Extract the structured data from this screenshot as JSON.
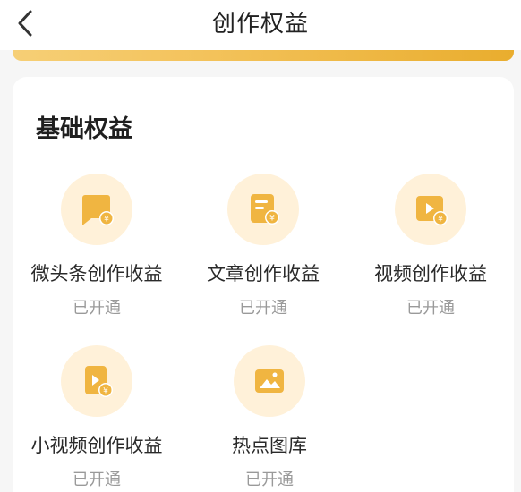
{
  "header": {
    "title": "创作权益",
    "back_icon": "chevron-left-icon"
  },
  "section": {
    "title": "基础权益"
  },
  "benefits": [
    {
      "label": "微头条创作收益",
      "status": "已开通",
      "icon": "chat-bubble-yuan-icon"
    },
    {
      "label": "文章创作收益",
      "status": "已开通",
      "icon": "document-yuan-icon"
    },
    {
      "label": "视频创作收益",
      "status": "已开通",
      "icon": "video-yuan-icon"
    },
    {
      "label": "小视频创作收益",
      "status": "已开通",
      "icon": "short-video-yuan-icon"
    },
    {
      "label": "热点图库",
      "status": "已开通",
      "icon": "image-gallery-icon"
    }
  ],
  "colors": {
    "accent_gold": "#f3c25a",
    "icon_bg": "#fff1d9",
    "icon_fill": "#f0b541",
    "status_text": "#9a9a9a"
  }
}
